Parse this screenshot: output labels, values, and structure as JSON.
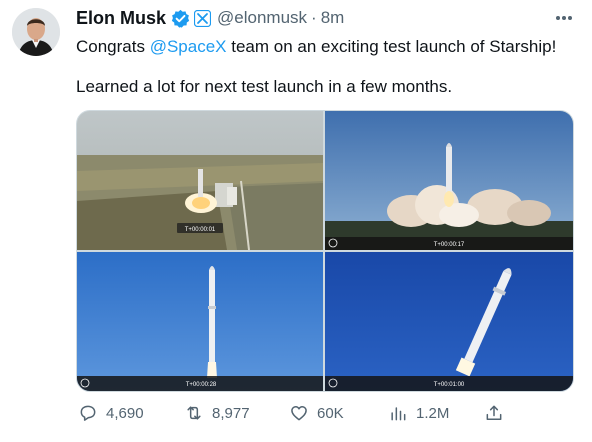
{
  "author": {
    "name": "Elon Musk",
    "handle": "@elonmusk",
    "separator": "·",
    "time": "8m"
  },
  "tweet": {
    "line1_prefix": "Congrats ",
    "line1_mention": "@SpaceX",
    "line1_suffix": " team on an exciting test launch of Starship!",
    "line2": "Learned a lot for next test launch in a few months."
  },
  "media": {
    "frames": [
      {
        "timer": "T+00:00:01"
      },
      {
        "timer": "T+00:00:17"
      },
      {
        "timer": "T+00:00:28"
      },
      {
        "timer": "T+00:01:00"
      }
    ]
  },
  "actions": {
    "replies": "4,690",
    "retweets": "8,977",
    "likes": "60K",
    "views": "1.2M"
  },
  "icons": {
    "verified": "verified-badge-icon",
    "affiliate": "x-affiliate-icon",
    "more": "more-icon",
    "reply": "reply-icon",
    "retweet": "retweet-icon",
    "like": "heart-icon",
    "views": "views-icon",
    "share": "share-icon"
  },
  "colors": {
    "accent": "#1d9bf0",
    "text": "#0f1419",
    "muted": "#536471",
    "verified": "#1d9bf0"
  }
}
